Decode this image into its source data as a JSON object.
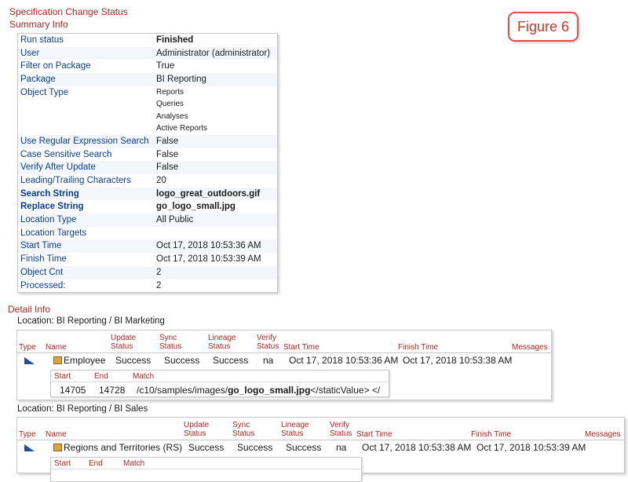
{
  "title": "Specification Change Status",
  "summary_title": "Summary Info",
  "figure_label": "Figure 6",
  "summary": [
    {
      "label": "Run status",
      "value": "Finished",
      "bold": true
    },
    {
      "label": "User",
      "value": "Administrator (administrator)"
    },
    {
      "label": "Filter on Package",
      "value": "True"
    },
    {
      "label": "Package",
      "value": "BI Reporting"
    },
    {
      "label": "Object Type",
      "values": [
        "Reports",
        "Queries",
        "Analyses",
        "Active Reports"
      ]
    },
    {
      "label": "Use Regular Expression Search",
      "value": "False"
    },
    {
      "label": "Case Sensitive Search",
      "value": "False"
    },
    {
      "label": "Verify After Update",
      "value": "False"
    },
    {
      "label": "Leading/Trailing Characters",
      "value": "20"
    },
    {
      "label": "Search String",
      "value": "logo_great_outdoors.gif",
      "bold": true
    },
    {
      "label": "Replace String",
      "value": "go_logo_small.jpg",
      "bold": true
    },
    {
      "label": "Location Type",
      "value": "All Public"
    },
    {
      "label": "Location Targets",
      "value": ""
    },
    {
      "label": "Start Time",
      "value": "Oct 17, 2018 10:53:36 AM"
    },
    {
      "label": "Finish Time",
      "value": "Oct 17, 2018 10:53:39 AM"
    },
    {
      "label": "Object Cnt",
      "value": "2"
    },
    {
      "label": "Processed:",
      "value": "2"
    }
  ],
  "detail_title": "Detail Info",
  "headers": {
    "type": "Type",
    "name": "Name",
    "update": "Update Status",
    "sync": "Sync Status",
    "lineage": "Lineage Status",
    "verify": "Verify Status",
    "start": "Start Time",
    "finish": "Finish Time",
    "messages": "Messages"
  },
  "sub_headers": {
    "start": "Start",
    "end": "End",
    "match": "Match"
  },
  "locations": [
    {
      "label": "Location: BI Reporting / BI Marketing",
      "row": {
        "name": "Employee",
        "update": "Success",
        "sync": "Success",
        "lineage": "Success",
        "verify": "na",
        "start": "Oct 17, 2018 10:53:36 AM",
        "finish": "Oct 17, 2018 10:53:38 AM"
      },
      "match": {
        "start": "14705",
        "end": "14728",
        "prefix": "/c10/samples/images/",
        "bold": "go_logo_small.jpg",
        "suffix": "</staticValue> </"
      }
    },
    {
      "label": "Location: BI Reporting / BI Sales",
      "row": {
        "name": "Regions and Territories (RS)",
        "update": "Success",
        "sync": "Success",
        "lineage": "Success",
        "verify": "na",
        "start": "Oct 17, 2018 10:53:38 AM",
        "finish": "Oct 17, 2018 10:53:39 AM"
      }
    }
  ]
}
